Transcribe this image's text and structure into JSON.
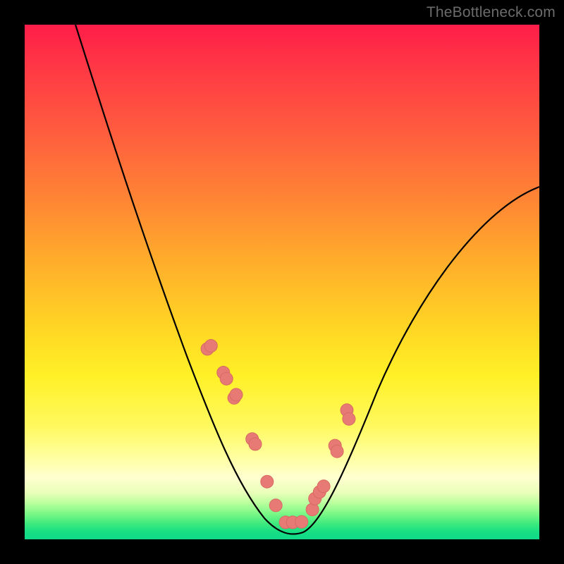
{
  "watermark": "TheBottleneck.com",
  "colors": {
    "frame": "#000000",
    "curve": "#000000",
    "dot_fill": "#e77a74",
    "dot_stroke": "#d86a63"
  },
  "chart_data": {
    "type": "line",
    "title": "",
    "xlabel": "",
    "ylabel": "",
    "xlim": [
      0,
      100
    ],
    "ylim": [
      0,
      100
    ],
    "series": [
      {
        "name": "bottleneck-curve",
        "x": [
          10,
          14,
          18,
          22,
          26,
          30,
          34,
          38,
          41,
          43,
          45,
          47,
          49,
          51,
          53,
          55,
          57,
          60,
          64,
          68,
          73,
          78,
          84,
          90,
          96,
          100
        ],
        "y": [
          100,
          90,
          79,
          68,
          57,
          47,
          38,
          29,
          21,
          15,
          10,
          6,
          3,
          2,
          2,
          3,
          6,
          11,
          19,
          27,
          35,
          43,
          51,
          58,
          64,
          68
        ]
      }
    ],
    "dots": {
      "name": "highlight-points",
      "x_percent": [
        35.5,
        36.2,
        38.6,
        39.2,
        40.7,
        41.1,
        44.2,
        44.8,
        47.1,
        48.8,
        50.7,
        52.1,
        53.8,
        55.9,
        56.4,
        57.3,
        58.1,
        60.3,
        60.7,
        62.6,
        63.0
      ],
      "y_percent": [
        63.0,
        62.4,
        67.6,
        68.8,
        72.5,
        71.9,
        80.5,
        81.5,
        88.8,
        93.4,
        96.7,
        96.7,
        96.6,
        94.2,
        92.1,
        90.8,
        89.7,
        81.8,
        82.9,
        74.9,
        76.6
      ]
    }
  }
}
